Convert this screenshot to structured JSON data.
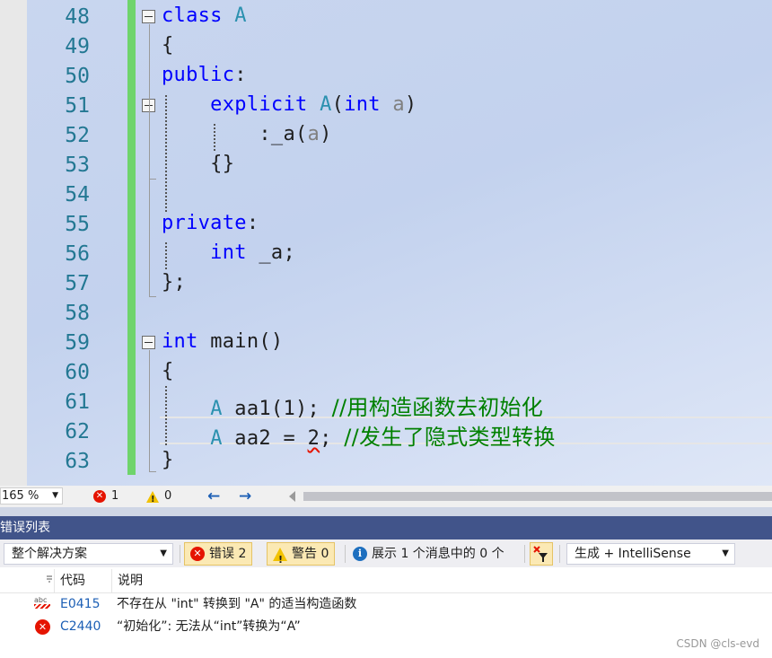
{
  "editor": {
    "lines": [
      {
        "num": "48",
        "tokens": [
          {
            "t": "class ",
            "c": "kw"
          },
          {
            "t": "A",
            "c": "ty"
          }
        ]
      },
      {
        "num": "49",
        "tokens": [
          {
            "t": "{",
            "c": ""
          }
        ]
      },
      {
        "num": "50",
        "tokens": [
          {
            "t": "public",
            "c": "kw"
          },
          {
            "t": ":",
            "c": ""
          }
        ]
      },
      {
        "num": "51",
        "tokens": [
          {
            "t": "    explicit ",
            "c": "kw"
          },
          {
            "t": "A",
            "c": "ty"
          },
          {
            "t": "(",
            "c": ""
          },
          {
            "t": "int ",
            "c": "kw"
          },
          {
            "t": "a",
            "c": "pm"
          },
          {
            "t": ")",
            "c": ""
          }
        ]
      },
      {
        "num": "52",
        "tokens": [
          {
            "t": "        :_a(",
            "c": ""
          },
          {
            "t": "a",
            "c": "pm"
          },
          {
            "t": ")",
            "c": ""
          }
        ]
      },
      {
        "num": "53",
        "tokens": [
          {
            "t": "    {}",
            "c": ""
          }
        ]
      },
      {
        "num": "54",
        "tokens": []
      },
      {
        "num": "55",
        "tokens": [
          {
            "t": "private",
            "c": "kw"
          },
          {
            "t": ":",
            "c": ""
          }
        ]
      },
      {
        "num": "56",
        "tokens": [
          {
            "t": "    int ",
            "c": "kw"
          },
          {
            "t": "_a;",
            "c": ""
          }
        ]
      },
      {
        "num": "57",
        "tokens": [
          {
            "t": "};",
            "c": ""
          }
        ]
      },
      {
        "num": "58",
        "tokens": []
      },
      {
        "num": "59",
        "tokens": [
          {
            "t": "int ",
            "c": "kw"
          },
          {
            "t": "main",
            "c": ""
          },
          {
            "t": "()",
            "c": ""
          }
        ]
      },
      {
        "num": "60",
        "tokens": [
          {
            "t": "{",
            "c": ""
          }
        ]
      },
      {
        "num": "61",
        "tokens": [
          {
            "t": "    ",
            "c": ""
          },
          {
            "t": "A",
            "c": "ty"
          },
          {
            "t": " aa1(1); ",
            "c": ""
          },
          {
            "t": "//用构造函数去初始化",
            "c": "cm"
          }
        ]
      },
      {
        "num": "62",
        "tokens": [
          {
            "t": "    ",
            "c": ""
          },
          {
            "t": "A",
            "c": "ty"
          },
          {
            "t": " aa2 = ",
            "c": ""
          },
          {
            "t": "2",
            "c": "sq"
          },
          {
            "t": "; ",
            "c": ""
          },
          {
            "t": "//发生了隐式类型转换",
            "c": "cm"
          }
        ]
      },
      {
        "num": "63",
        "tokens": [
          {
            "t": "}",
            "c": ""
          }
        ]
      }
    ]
  },
  "statusbar": {
    "zoom": "165 %",
    "errors": "1",
    "warnings": "0"
  },
  "error_list": {
    "title": "错误列表",
    "scope": "整个解决方案",
    "errors_btn": "错误 2",
    "warnings_btn": "警告 0",
    "messages_btn": "展示 1 个消息中的 0 个",
    "build_filter": "生成 + IntelliSense",
    "columns": {
      "code": "代码",
      "desc": "说明"
    },
    "rows": [
      {
        "code": "E0415",
        "desc": "不存在从 \"int\" 转换到 \"A\" 的适当构造函数"
      },
      {
        "code": "C2440",
        "desc": "“初始化”: 无法从“int”转换为“A”"
      }
    ]
  },
  "watermark": "CSDN @cls-evd",
  "colors": {
    "keyword": "#0000ff",
    "type": "#2b91af",
    "comment": "#008000",
    "linenum": "#237893",
    "panel_title": "#41548a"
  }
}
